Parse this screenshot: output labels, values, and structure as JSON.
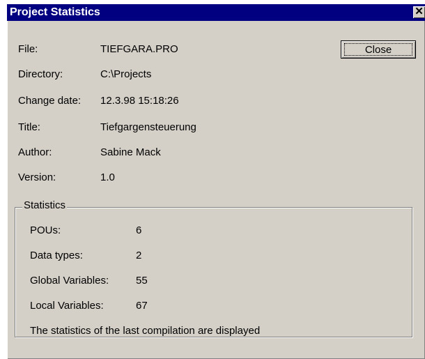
{
  "window": {
    "title": "Project Statistics",
    "close_glyph": "✕"
  },
  "info": {
    "file_label": "File:",
    "file_value": "TIEFGARA.PRO",
    "directory_label": "Directory:",
    "directory_value": "C:\\Projects",
    "change_date_label": "Change date:",
    "change_date_value": "12.3.98 15:18:26",
    "title_label": "Title:",
    "title_value": "Tiefgargensteuerung",
    "author_label": "Author:",
    "author_value": "Sabine Mack",
    "version_label": "Version:",
    "version_value": "1.0"
  },
  "buttons": {
    "close_label": "Close"
  },
  "statistics": {
    "legend": "Statistics",
    "pous_label": "POUs:",
    "pous_value": "6",
    "data_types_label": "Data types:",
    "data_types_value": "2",
    "global_vars_label": "Global Variables:",
    "global_vars_value": "55",
    "local_vars_label": "Local Variables:",
    "local_vars_value": "67",
    "note": "The statistics of the last compilation are displayed"
  }
}
